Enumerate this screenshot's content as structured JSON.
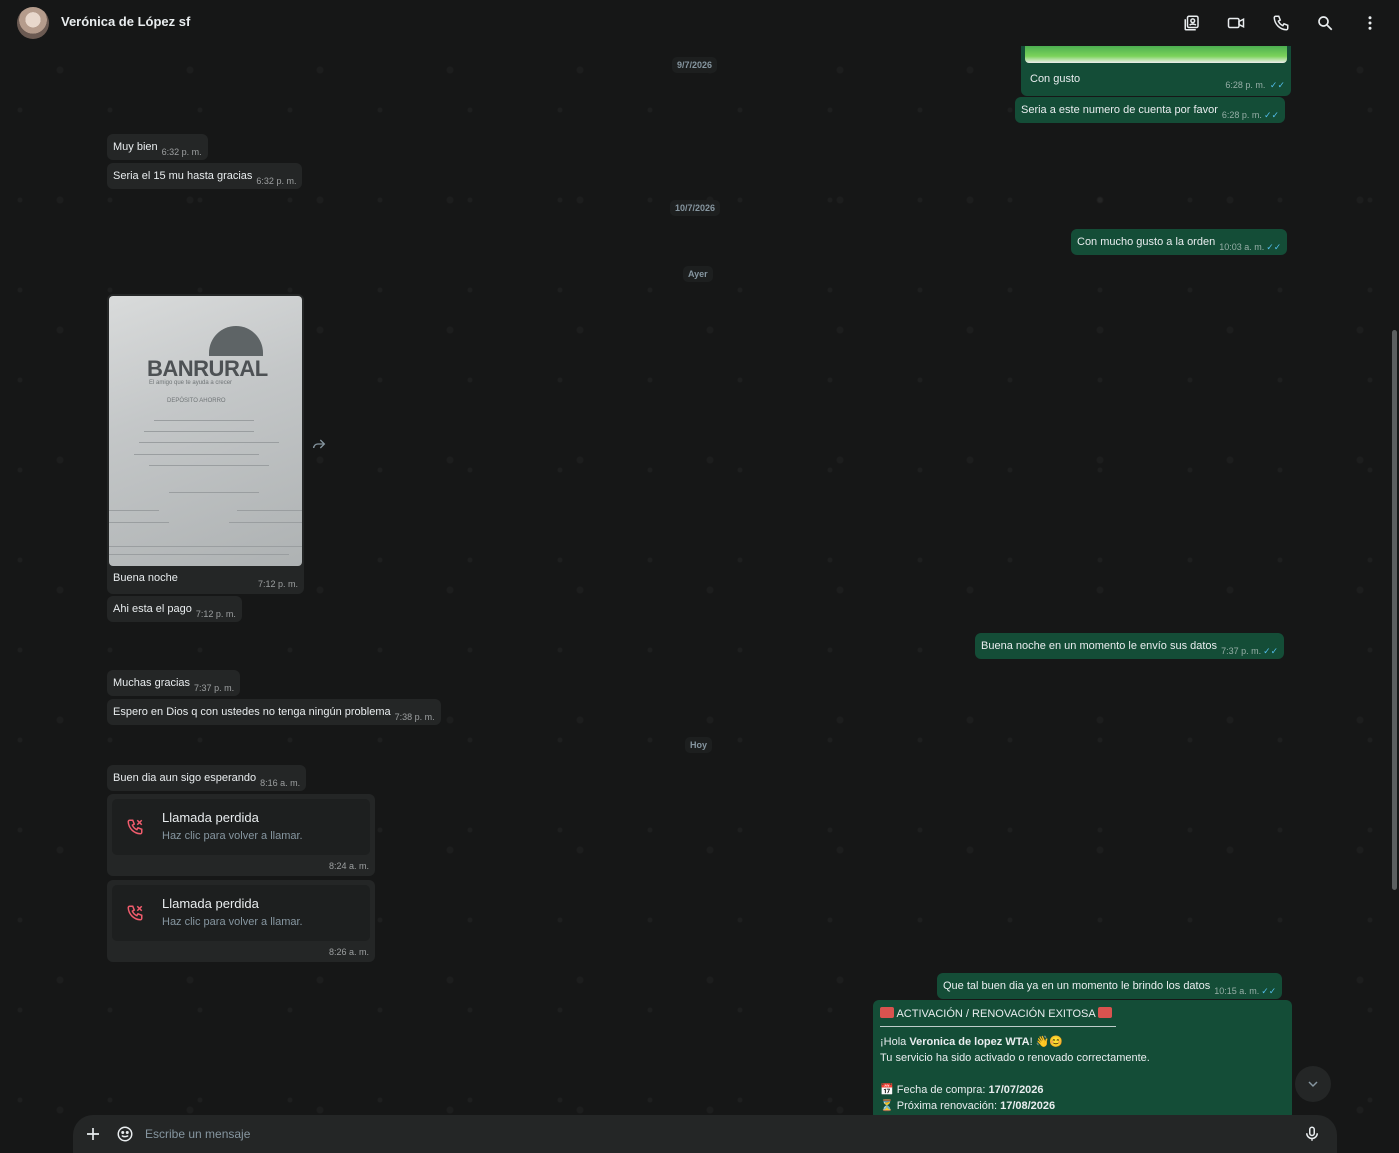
{
  "header": {
    "contact_name": "Verónica de López sf",
    "icons": [
      "contact-card-icon",
      "video-call-icon",
      "phone-icon",
      "search-icon",
      "more-vertical-icon"
    ]
  },
  "date_chips": {
    "d1": "9/7/2026",
    "d2": "10/7/2026",
    "d3": "Ayer",
    "d4": "Hoy"
  },
  "messages": {
    "photo_caption": "Con gusto",
    "photo_caption_time": "6:28 p. m.",
    "m1": {
      "text": "Seria a este numero de cuenta por favor",
      "time": "6:28 p. m."
    },
    "m2": {
      "text": "Muy bien",
      "time": "6:32 p. m."
    },
    "m3": {
      "text": "Seria el 15 mu hasta gracias",
      "time": "6:32 p. m."
    },
    "m4": {
      "text": "Con mucho gusto a la orden",
      "time": "10:03 a. m."
    },
    "receipt": {
      "logo": "BANRURAL",
      "slogan": "El amigo que te ayuda a crecer",
      "doc_type": "DEPÓSITO AHORRO",
      "caption": "Buena noche",
      "time": "7:12 p. m."
    },
    "m5": {
      "text": "Ahi esta el pago",
      "time": "7:12 p. m."
    },
    "m6": {
      "text": "Buena noche en un momento le envío sus datos",
      "time": "7:37 p. m."
    },
    "m7": {
      "text": "Muchas gracias",
      "time": "7:37 p. m."
    },
    "m8": {
      "text": "Espero en Dios q con ustedes no tenga ningún problema",
      "time": "7:38 p. m."
    },
    "m9": {
      "text": "Buen dia aun sigo esperando",
      "time": "8:16 a. m."
    },
    "call1": {
      "title": "Llamada perdida",
      "subtitle": "Haz clic para volver a llamar.",
      "time": "8:24 a. m."
    },
    "call2": {
      "title": "Llamada perdida",
      "subtitle": "Haz clic para volver a llamar.",
      "time": "8:26 a. m."
    },
    "m10": {
      "text": "Que tal buen dia ya en un momento le brindo los datos",
      "time": "10:15 a. m."
    },
    "activation": {
      "title": "ACTIVACIÓN / RENOVACIÓN EXITOSA",
      "greeting_pre": "¡Hola ",
      "greeting_name": "Veronica de lopez WTA",
      "greeting_post": "! 👋😊",
      "line2": "Tu servicio ha sido activado o renovado correctamente.",
      "purchase_label": "Fecha de compra: ",
      "purchase_date": "17/07/2026",
      "renewal_label": "Próxima renovación: ",
      "renewal_date": "17/08/2026"
    }
  },
  "composer": {
    "placeholder": "Escribe un mensaje"
  },
  "colors": {
    "incoming_bubble": "#242626",
    "outgoing_bubble": "#144d37",
    "read_ticks": "#53bdeb",
    "missed_call": "#f15c6d"
  }
}
